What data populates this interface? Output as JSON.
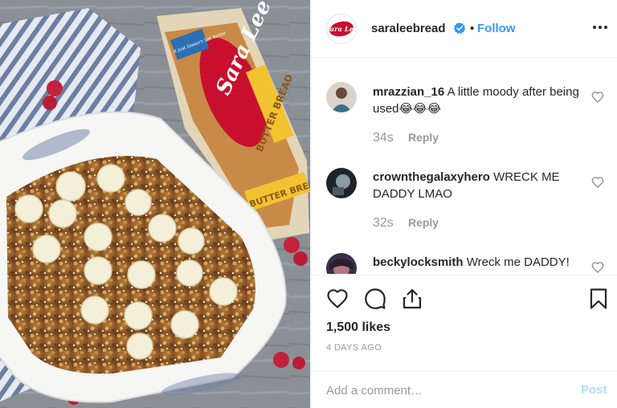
{
  "post": {
    "username": "saraleebread",
    "follow_label": "Follow",
    "separator": "•",
    "brand_logo_text": "Sara Lee",
    "photo_bag_text": "BUTTER BREAD",
    "photo_tag_text": "It Just Doesn't Get Better",
    "icons": {
      "verified": "verified-badge-icon",
      "more": "more-options-icon",
      "like": "heart-icon",
      "comment": "comment-bubble-icon",
      "share": "share-icon",
      "save": "bookmark-icon"
    }
  },
  "comments": [
    {
      "username": "mrazzian_16",
      "text": "A little moody after being used😂😂😂",
      "time": "34s",
      "reply_label": "Reply"
    },
    {
      "username": "crownthegalaxyhero",
      "text": "WRECK ME DADDY LMAO",
      "time": "32s",
      "reply_label": "Reply"
    },
    {
      "username": "beckylocksmith",
      "text": "Wreck me DADDY!",
      "time": "",
      "reply_label": ""
    }
  ],
  "likes_text": "1,500 likes",
  "date_text": "4 DAYS AGO",
  "add_comment": {
    "placeholder": "Add a comment…",
    "post_label": "Post"
  },
  "colors": {
    "link": "#3897f0",
    "post_disabled": "#b3dbff",
    "brand_red": "#c8102e"
  }
}
